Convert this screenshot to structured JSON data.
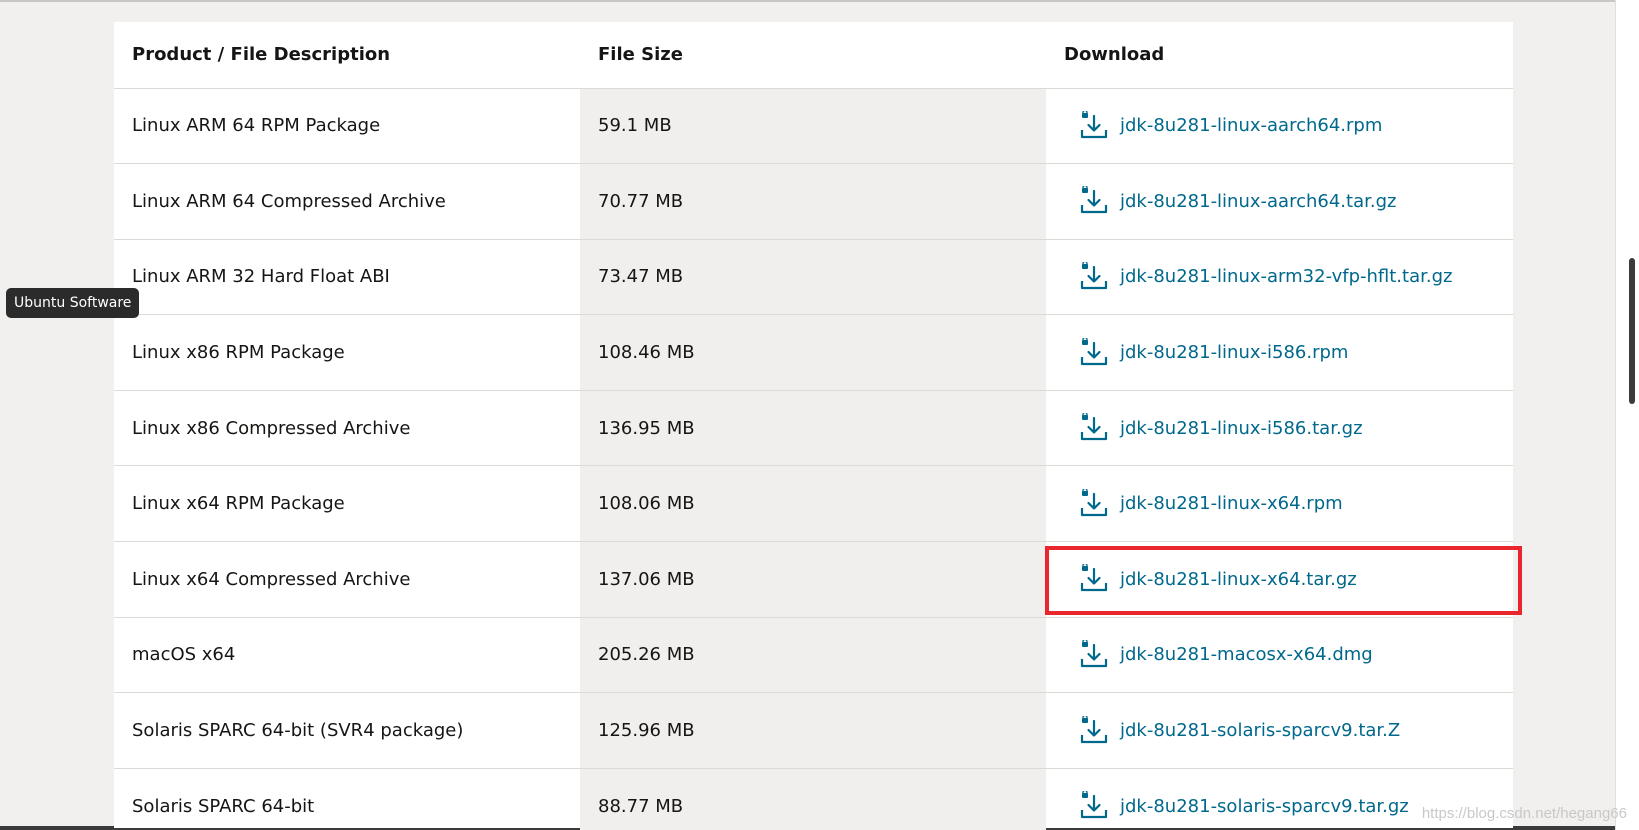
{
  "tooltip": "Ubuntu Software",
  "watermark": "https://blog.csdn.net/hegang66",
  "table": {
    "headers": [
      "Product / File Description",
      "File Size",
      "Download"
    ],
    "rows": [
      {
        "desc": "Linux ARM 64 RPM Package",
        "size": "59.1 MB",
        "file": "jdk-8u281-linux-aarch64.rpm"
      },
      {
        "desc": "Linux ARM 64 Compressed Archive",
        "size": "70.77 MB",
        "file": "jdk-8u281-linux-aarch64.tar.gz"
      },
      {
        "desc": "Linux ARM 32 Hard Float ABI",
        "size": "73.47 MB",
        "file": "jdk-8u281-linux-arm32-vfp-hflt.tar.gz"
      },
      {
        "desc": "Linux x86 RPM Package",
        "size": "108.46 MB",
        "file": "jdk-8u281-linux-i586.rpm"
      },
      {
        "desc": "Linux x86 Compressed Archive",
        "size": "136.95 MB",
        "file": "jdk-8u281-linux-i586.tar.gz"
      },
      {
        "desc": "Linux x64 RPM Package",
        "size": "108.06 MB",
        "file": "jdk-8u281-linux-x64.rpm"
      },
      {
        "desc": "Linux x64 Compressed Archive",
        "size": "137.06 MB",
        "file": "jdk-8u281-linux-x64.tar.gz"
      },
      {
        "desc": "macOS x64",
        "size": "205.26 MB",
        "file": "jdk-8u281-macosx-x64.dmg"
      },
      {
        "desc": "Solaris SPARC 64-bit (SVR4 package)",
        "size": "125.96 MB",
        "file": "jdk-8u281-solaris-sparcv9.tar.Z"
      },
      {
        "desc": "Solaris SPARC 64-bit",
        "size": "88.77 MB",
        "file": "jdk-8u281-solaris-sparcv9.tar.gz"
      }
    ]
  },
  "icons": {
    "download": "download-lock-icon"
  },
  "colors": {
    "link": "#00688c",
    "highlight": "#e8262c",
    "size_col_bg": "#f1efed"
  }
}
